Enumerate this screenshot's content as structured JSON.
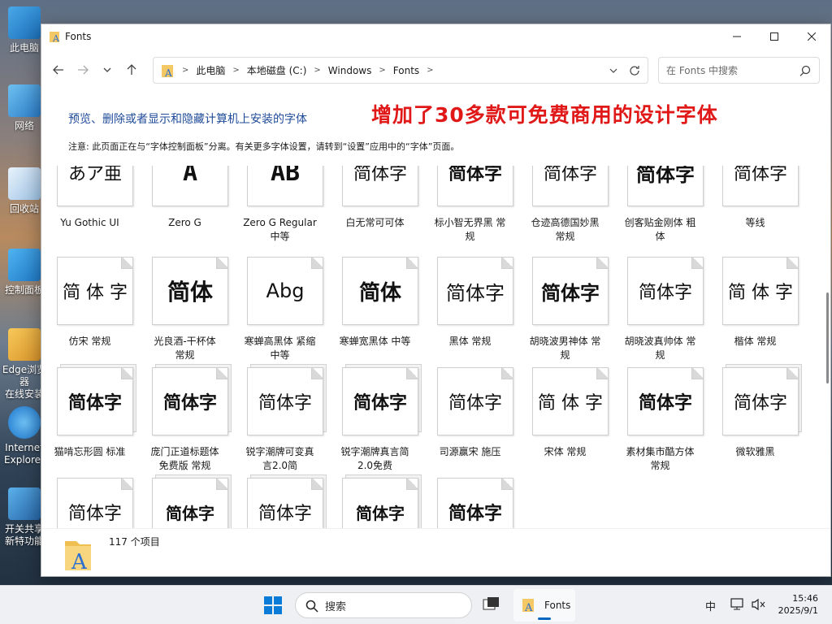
{
  "desktop": {
    "icons": [
      {
        "label1": "此电脑",
        "label2": ""
      },
      {
        "label1": "网络",
        "label2": ""
      },
      {
        "label1": "回收站",
        "label2": ""
      },
      {
        "label1": "控制面板",
        "label2": ""
      },
      {
        "label1": "Edge浏览器",
        "label2": "在线安装"
      },
      {
        "label1": "Internet",
        "label2": "Explorer"
      },
      {
        "label1": "开关共享",
        "label2": "新特功能"
      }
    ]
  },
  "window": {
    "title": "Fonts",
    "title_icon": "font-folder-icon",
    "controls": {
      "minimize": "minimize-icon",
      "maximize": "maximize-icon",
      "close": "close-icon"
    }
  },
  "address": {
    "crumbs": [
      "此电脑",
      "本地磁盘 (C:)",
      "Windows",
      "Fonts"
    ]
  },
  "search": {
    "placeholder": "在 Fonts 中搜索"
  },
  "header": {
    "description": "预览、删除或者显示和隐藏计算机上安装的字体",
    "promo": "增加了30多款可免费商用的设计字体",
    "note": "注意: 此页面正在与“字体控制面板”分离。有关更多字体设置，请转到“设置”应用中的“字体”页面。"
  },
  "fonts": [
    {
      "sample": "あア亜",
      "label": "Yu Gothic UI",
      "label2": ""
    },
    {
      "sample": "A",
      "label": "Zero G",
      "label2": ""
    },
    {
      "sample": "AB",
      "label": "Zero G Regular",
      "label2": "中等"
    },
    {
      "sample": "简体字",
      "label": "白无常可可体",
      "label2": ""
    },
    {
      "sample": "简体字",
      "label": "标小智无界黑 常",
      "label2": "规"
    },
    {
      "sample": "简体字",
      "label": "仓迹高德国妙黑",
      "label2": "常规"
    },
    {
      "sample": "简体字",
      "label": "创客贴金刚体 粗",
      "label2": "体"
    },
    {
      "sample": "简体字",
      "label": "等线",
      "label2": ""
    },
    {
      "sample": "简 体 字",
      "label": "仿宋 常规",
      "label2": ""
    },
    {
      "sample": "简体",
      "label": "光良酒-干杯体",
      "label2": "常规"
    },
    {
      "sample": "Abg",
      "label": "寒蝉高黑体 紧缩",
      "label2": "中等"
    },
    {
      "sample": "简体",
      "label": "寒蝉宽黑体 中等",
      "label2": ""
    },
    {
      "sample": "简体字",
      "label": "黑体 常规",
      "label2": ""
    },
    {
      "sample": "简体字",
      "label": "胡晓波男神体 常",
      "label2": "规"
    },
    {
      "sample": "简体字",
      "label": "胡晓波真帅体 常",
      "label2": "规"
    },
    {
      "sample": "简 体 字",
      "label": "楷体 常规",
      "label2": ""
    },
    {
      "sample": "简体字",
      "label": "猫啃忘形圆 标准",
      "label2": ""
    },
    {
      "sample": "简体字",
      "label": "庞门正道标题体",
      "label2": "免费版 常规"
    },
    {
      "sample": "简体字",
      "label": "锐字潮牌可变真",
      "label2": "言2.0简"
    },
    {
      "sample": "简体字",
      "label": "锐字潮牌真言简",
      "label2": "2.0免费"
    },
    {
      "sample": "简体字",
      "label": "司源赢宋 施压",
      "label2": ""
    },
    {
      "sample": "简 体 字",
      "label": "宋体 常规",
      "label2": ""
    },
    {
      "sample": "简体字",
      "label": "素材集市酷方体",
      "label2": "常规"
    },
    {
      "sample": "简体字",
      "label": "微软雅黑",
      "label2": ""
    },
    {
      "sample": "简体字",
      "label": "",
      "label2": ""
    },
    {
      "sample": "简体字",
      "label": "",
      "label2": ""
    },
    {
      "sample": "简体字",
      "label": "",
      "label2": ""
    },
    {
      "sample": "简体字",
      "label": "",
      "label2": ""
    },
    {
      "sample": "简体字",
      "label": "",
      "label2": ""
    }
  ],
  "status": {
    "count": "117 个项目"
  },
  "taskbar": {
    "search_label": "搜索",
    "app_label": "Fonts",
    "ime": "中",
    "time": "15:46",
    "date": "2025/9/1"
  },
  "colors": {
    "accent": "#0067c0",
    "promo": "#e01818",
    "description": "#1f4b99"
  }
}
